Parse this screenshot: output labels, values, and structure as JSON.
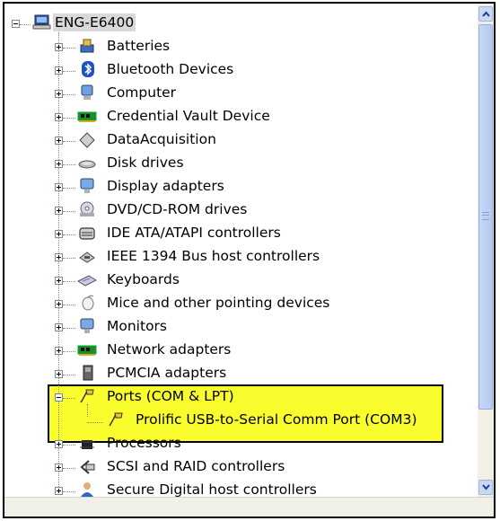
{
  "root": {
    "label": "ENG-E6400"
  },
  "items": [
    {
      "label": "Batteries",
      "icon": "battery-icon"
    },
    {
      "label": "Bluetooth Devices",
      "icon": "bluetooth-icon"
    },
    {
      "label": "Computer",
      "icon": "computer-icon"
    },
    {
      "label": "Credential Vault Device",
      "icon": "circuit-board-icon"
    },
    {
      "label": "DataAcquisition",
      "icon": "diamond-icon"
    },
    {
      "label": "Disk drives",
      "icon": "disk-drive-icon"
    },
    {
      "label": "Display adapters",
      "icon": "monitor-icon"
    },
    {
      "label": "DVD/CD-ROM drives",
      "icon": "cd-drive-icon"
    },
    {
      "label": "IDE ATA/ATAPI controllers",
      "icon": "ide-controller-icon"
    },
    {
      "label": "IEEE 1394 Bus host controllers",
      "icon": "firewire-icon"
    },
    {
      "label": "Keyboards",
      "icon": "keyboard-icon"
    },
    {
      "label": "Mice and other pointing devices",
      "icon": "mouse-icon"
    },
    {
      "label": "Monitors",
      "icon": "monitor-icon"
    },
    {
      "label": "Network adapters",
      "icon": "network-card-icon"
    },
    {
      "label": "PCMCIA adapters",
      "icon": "pcmcia-icon"
    },
    {
      "label": "Ports (COM & LPT)",
      "icon": "port-connector-icon",
      "expanded": true
    },
    {
      "label": "Processors",
      "icon": "processor-icon"
    },
    {
      "label": "SCSI and RAID controllers",
      "icon": "scsi-icon"
    },
    {
      "label": "Secure Digital host controllers",
      "icon": "sd-host-icon"
    }
  ],
  "child": {
    "label": "Prolific USB-to-Serial Comm Port (COM3)",
    "icon": "port-connector-icon"
  },
  "colors": {
    "highlight": "#fafd2d",
    "selection": "#d9d9d9",
    "scrollbar": "#c9d8f5"
  }
}
